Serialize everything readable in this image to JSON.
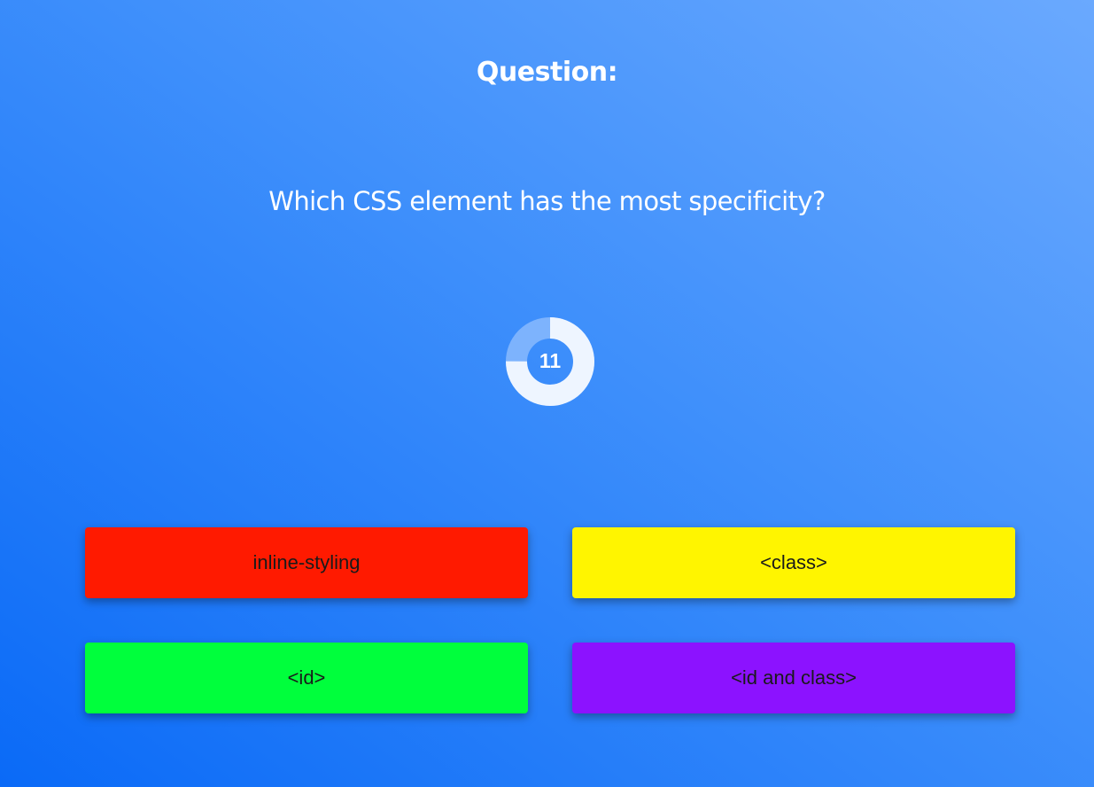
{
  "header": {
    "title": "Question:"
  },
  "question": {
    "text": "Which CSS element has the most specificity?"
  },
  "timer": {
    "value": "11",
    "remaining_fraction": 0.75,
    "ring_color": "#eef5ff",
    "track_color": "#7db3fd"
  },
  "answers": [
    {
      "label": "inline-styling",
      "color": "#ff1a00"
    },
    {
      "label": "<class>",
      "color": "#fff500"
    },
    {
      "label": "<id>",
      "color": "#00ff3c"
    },
    {
      "label": "<id and class>",
      "color": "#8c12ff"
    }
  ]
}
